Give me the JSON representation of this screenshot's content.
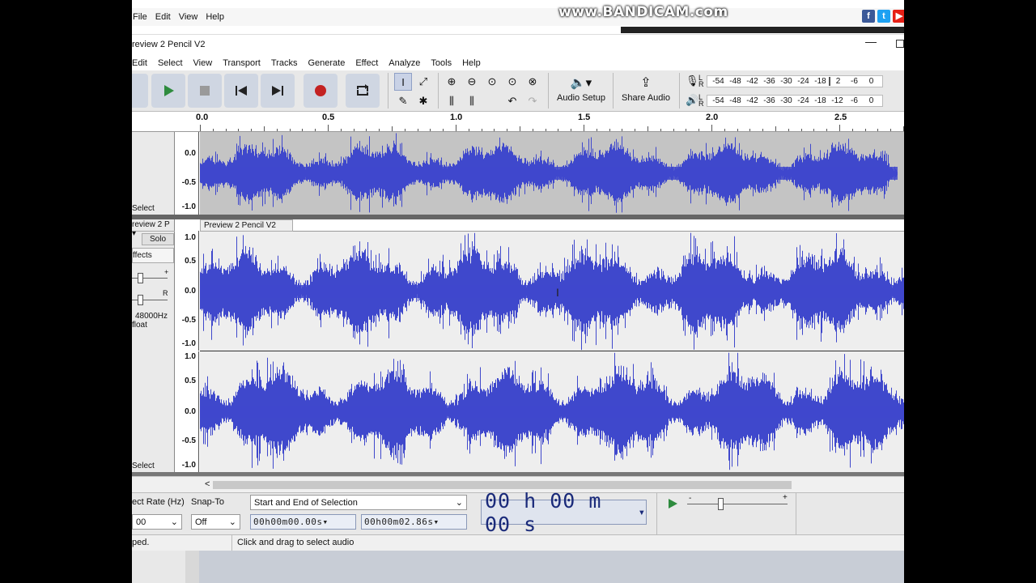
{
  "watermark": "www.BANDICAM.com",
  "outer_menu": [
    "File",
    "Edit",
    "View",
    "Help"
  ],
  "social": [
    {
      "label": "f",
      "color": "#3b5998"
    },
    {
      "label": "t",
      "color": "#1da1f2"
    },
    {
      "label": "▶",
      "color": "#e62117"
    }
  ],
  "window_title": "review 2 Pencil V2",
  "menu": [
    "Edit",
    "Select",
    "View",
    "Transport",
    "Tracks",
    "Generate",
    "Effect",
    "Analyze",
    "Tools",
    "Help"
  ],
  "toolbar": {
    "audio_setup": "Audio Setup",
    "share_audio": "Share Audio",
    "rec_meter": {
      "L": "L",
      "R": "R",
      "scale": [
        "-54",
        "-48",
        "-42",
        "-36",
        "-30",
        "-24",
        "-18",
        "2",
        "-6",
        "0"
      ]
    },
    "play_meter": {
      "L": "L",
      "R": "R",
      "scale": [
        "-54",
        "-48",
        "-42",
        "-36",
        "-30",
        "-24",
        "-18",
        "-12",
        "-6",
        "0"
      ]
    }
  },
  "ruler": [
    "0.0",
    "0.5",
    "1.0",
    "1.5",
    "2.0",
    "2.5"
  ],
  "track1": {
    "scale": [
      "0.0",
      "-0.5",
      "-1.0"
    ],
    "select_label": "Select"
  },
  "track2": {
    "name_btn": "review 2 P",
    "solo": "Solo",
    "effects": "ffects",
    "gain_plus": "+",
    "pan_r": "R",
    "format_rate": "48000Hz",
    "format_type": "float",
    "clip_name": "Preview 2 Pencil V2",
    "scale_top": [
      "1.0",
      "0.5",
      "0.0",
      "-0.5",
      "-1.0"
    ],
    "scale_bottom": [
      "1.0",
      "0.5",
      "0.0",
      "-0.5",
      "-1.0"
    ],
    "select_label": "Select"
  },
  "scroll_left": "<",
  "selection_toolbar": {
    "rate_label": "ect Rate (Hz)",
    "rate_value": "00",
    "snap_label": "Snap-To",
    "snap_value": "Off",
    "mode": "Start and End of Selection",
    "start": "00h00m00.00s",
    "end": "00h00m02.86s",
    "time": "00 h 00 m 00 s",
    "speed_minus": "-",
    "speed_plus": "+"
  },
  "status": {
    "left": "ped.",
    "hint": "Click and drag to select audio"
  },
  "colors": {
    "wave": "#3f48cc",
    "wave_bg": "#c4c4c4",
    "wave_bg2": "#eeeeee"
  }
}
